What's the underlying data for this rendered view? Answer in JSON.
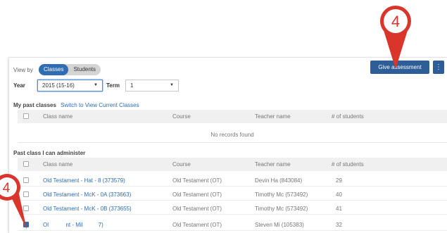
{
  "callouts": [
    {
      "number": "4"
    },
    {
      "number": "4"
    }
  ],
  "view_by": {
    "label": "View by",
    "options": [
      "Classes",
      "Students"
    ],
    "selected": "Classes"
  },
  "filters": {
    "year_label": "Year",
    "year_value": "2015 (15-16)",
    "term_label": "Term",
    "term_value": "1"
  },
  "actions": {
    "give_assessment": "Give assessment",
    "more": "⋮"
  },
  "past_classes": {
    "title": "My past classes",
    "switch_link": "Switch to View Current Classes",
    "columns": [
      "Class name",
      "Course",
      "Teacher name",
      "# of students"
    ],
    "empty_message": "No records found"
  },
  "admin_classes": {
    "title": "Past class I can administer",
    "columns": [
      "Class name",
      "Course",
      "Teacher name",
      "# of students"
    ],
    "rows": [
      {
        "name": "Old Testament - Hat - 8 (373579)",
        "course": "Old Testament (OT)",
        "teacher": "Devin Ha (843084)",
        "students": "29",
        "checked": false
      },
      {
        "name": "Old Testament - McK - 0A (373663)",
        "course": "Old Testament (OT)",
        "teacher": "Timothy Mc (573492)",
        "students": "40",
        "checked": false
      },
      {
        "name": "Old Testament - McK - 0B (373655)",
        "course": "Old Testament (OT)",
        "teacher": "Timothy Mc (573492)",
        "students": "41",
        "checked": false
      },
      {
        "name": "Ol           nt - Mil          7)",
        "course": "Old Testament (OT)",
        "teacher": "Steven Mi (105383)",
        "students": "32",
        "checked": true
      }
    ]
  },
  "colors": {
    "accent": "#2e6db4",
    "button": "#2e5e98",
    "callout": "#d9352b"
  }
}
